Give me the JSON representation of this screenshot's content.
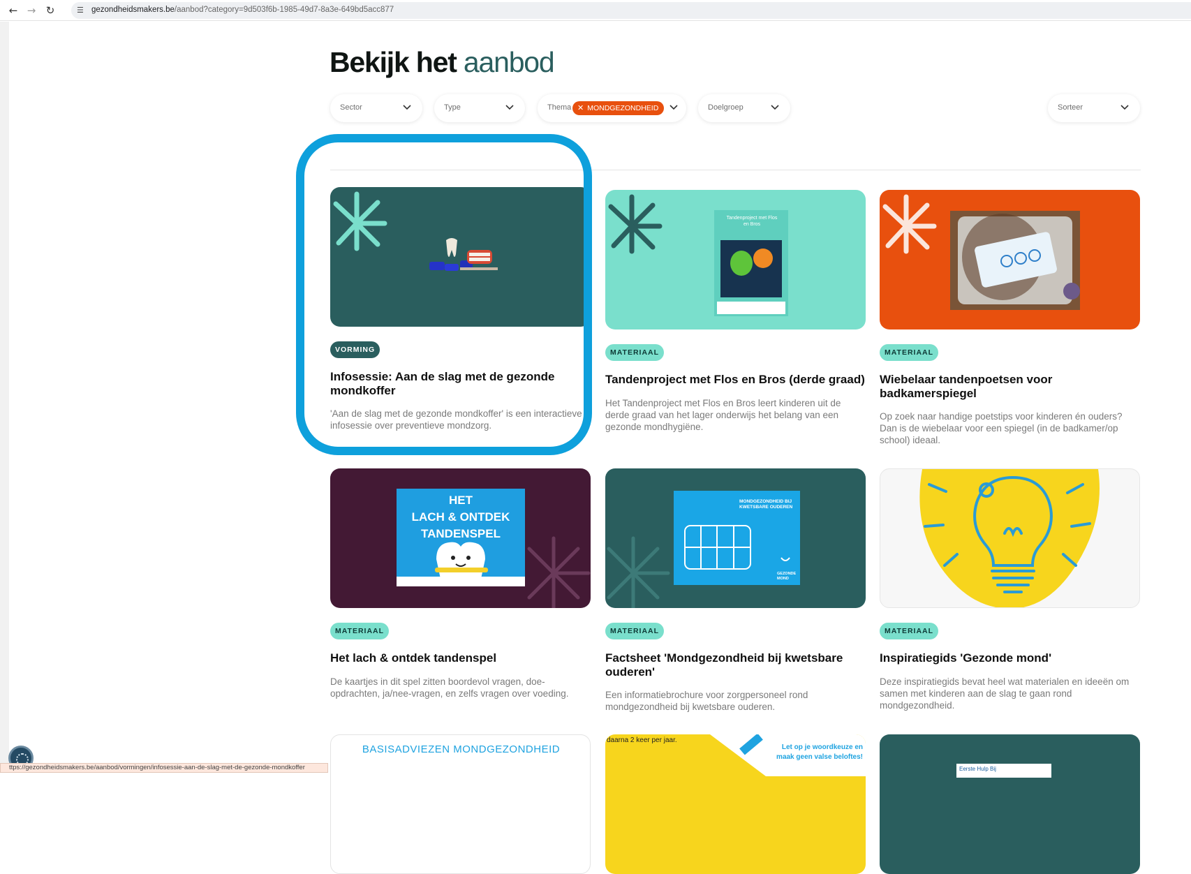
{
  "browser": {
    "back_icon": "arrow-left-icon",
    "forward_icon": "arrow-right-icon",
    "reload_icon": "reload-icon",
    "url_host": "gezondheidsmakers.be",
    "url_path": "/aanbod?category=9d503f6b-1985-49d7-8a3e-649bd5acc877",
    "status_url": "ttps://gezondheidsmakers.be/aanbod/vormingen/infosessie-aan-de-slag-met-de-gezonde-mondkoffer"
  },
  "page": {
    "title_main": "Bekijk het ",
    "title_accent": "aanbod"
  },
  "filters": {
    "sector": "Sector",
    "type": "Type",
    "thema": "Thema",
    "thema_chip": "MONDGEZONDHEID",
    "doelgroep": "Doelgroep",
    "sorteer": "Sorteer"
  },
  "colors": {
    "dark_teal": "#2a5e5e",
    "mint": "#7adfcc",
    "orange": "#e8500e",
    "plum": "#431934",
    "highlight_blue": "#0ea0dc"
  },
  "cards": [
    {
      "badge": "VORMING",
      "title": "Infosessie: Aan de slag met de gezonde mondkoffer",
      "desc": "'Aan de slag met de gezonde mondkoffer' is een interactieve infosessie over preventieve mondzorg."
    },
    {
      "badge": "MATERIAAL",
      "title": "Tandenproject met Flos en Bros (derde graad)",
      "desc": "Het Tandenproject met Flos en Bros leert kinderen uit de derde graad van het lager onderwijs het belang van een gezonde mondhygiëne.",
      "poster_text": "Tandenproject met Flos en Bros"
    },
    {
      "badge": "MATERIAAL",
      "title": "Wiebelaar tandenpoetsen voor badkamerspiegel",
      "desc": "Op zoek naar handige poetstips voor kinderen én ouders? Dan is de wiebelaar voor een spiegel (in de badkamer/op school) ideaal."
    },
    {
      "badge": "MATERIAAL",
      "title": "Het lach & ontdek tandenspel",
      "desc": "De kaartjes in dit spel zitten boordevol vragen, doe-opdrachten, ja/nee-vragen, en zelfs vragen over voeding.",
      "poster_lines": [
        "HET",
        "LACH & ONTDEK",
        "TANDENSPEL"
      ]
    },
    {
      "badge": "MATERIAAL",
      "title": "Factsheet 'Mondgezondheid bij kwetsbare ouderen'",
      "desc": "Een informatiebrochure voor zorgpersoneel rond mondgezondheid bij kwetsbare ouderen.",
      "poster_title": "MONDGEZONDHEID BIJ KWETSBARE OUDEREN",
      "poster_logo": "GEZONDE MOND"
    },
    {
      "badge": "MATERIAAL",
      "title": "Inspiratiegids 'Gezonde mond'",
      "desc": "Deze inspiratiegids bevat heel wat materialen en ideeën om samen met kinderen aan de slag te gaan rond mondgezondheid."
    }
  ],
  "bottom_row": {
    "card7_text": "BASISADVIEZEN MONDGEZONDHEID",
    "card8_text_left": "daarna 2 keer per jaar.",
    "card8_text_right_1": "Let op je woordkeuze en",
    "card8_text_right_2": "maak geen valse beloftes!",
    "card9_text": "Eerste Hulp Bij"
  }
}
